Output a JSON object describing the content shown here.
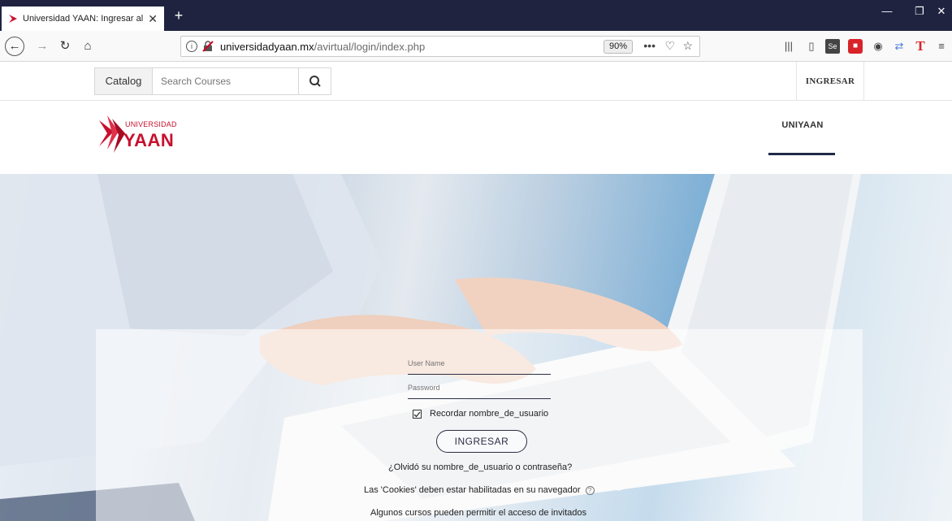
{
  "browser": {
    "tab_title": "Universidad YAAN: Ingresar al s",
    "url_domain": "universidadyaan.mx",
    "url_path": "/avirtual/login/index.php",
    "zoom": "90%"
  },
  "topbar": {
    "catalog_label": "Catalog",
    "search_placeholder": "Search Courses",
    "login_label": "INGRESAR"
  },
  "header": {
    "logo_line1": "UNIVERSIDAD",
    "logo_line2": "YAAN",
    "menu_item": "UNIYAAN"
  },
  "login": {
    "username_placeholder": "User Name",
    "password_placeholder": "Password",
    "remember_label": "Recordar nombre_de_usuario",
    "remember_checked": true,
    "submit_label": "INGRESAR",
    "forgot_link": "¿Olvidó su nombre_de_usuario o contraseña?",
    "cookies_notice": "Las 'Cookies' deben estar habilitadas en su navegador",
    "guests_notice": "Algunos cursos pueden permitir el acceso de invitados"
  },
  "colors": {
    "brand_red": "#c8102e",
    "navy": "#1e2a47",
    "tabbar": "#202340"
  }
}
